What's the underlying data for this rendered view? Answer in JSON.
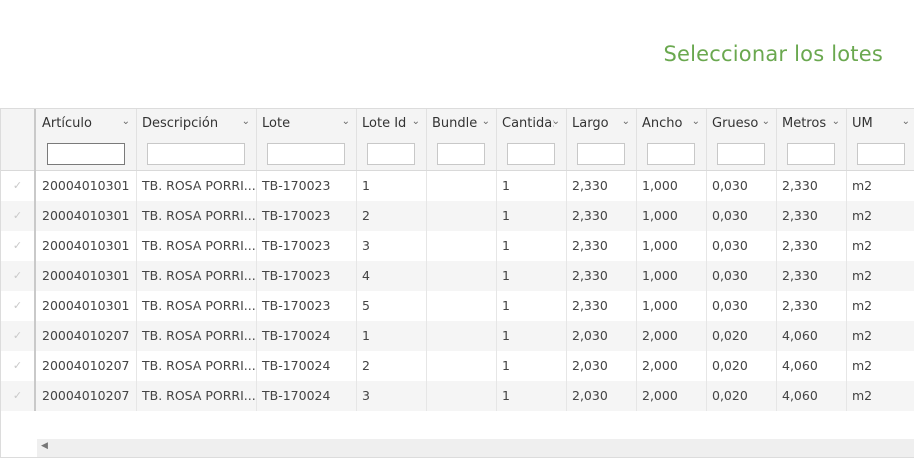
{
  "page": {
    "title": "Seleccionar los lotes"
  },
  "grid": {
    "columns": [
      {
        "label": "Artículo"
      },
      {
        "label": "Descripción"
      },
      {
        "label": "Lote"
      },
      {
        "label": "Lote Id"
      },
      {
        "label": "Bundle"
      },
      {
        "label": "Cantida:"
      },
      {
        "label": "Largo"
      },
      {
        "label": "Ancho"
      },
      {
        "label": "Grueso"
      },
      {
        "label": "Metros"
      },
      {
        "label": "UM"
      }
    ],
    "filter_values": [
      "",
      "",
      "",
      "",
      "",
      "",
      "",
      "",
      "",
      "",
      ""
    ],
    "rows": [
      [
        "20004010301",
        "TB. ROSA PORRI...",
        "TB-170023",
        "1",
        "",
        "1",
        "2,330",
        "1,000",
        "0,030",
        "2,330",
        "m2"
      ],
      [
        "20004010301",
        "TB. ROSA PORRI...",
        "TB-170023",
        "2",
        "",
        "1",
        "2,330",
        "1,000",
        "0,030",
        "2,330",
        "m2"
      ],
      [
        "20004010301",
        "TB. ROSA PORRI...",
        "TB-170023",
        "3",
        "",
        "1",
        "2,330",
        "1,000",
        "0,030",
        "2,330",
        "m2"
      ],
      [
        "20004010301",
        "TB. ROSA PORRI...",
        "TB-170023",
        "4",
        "",
        "1",
        "2,330",
        "1,000",
        "0,030",
        "2,330",
        "m2"
      ],
      [
        "20004010301",
        "TB. ROSA PORRI...",
        "TB-170023",
        "5",
        "",
        "1",
        "2,330",
        "1,000",
        "0,030",
        "2,330",
        "m2"
      ],
      [
        "20004010207",
        "TB. ROSA PORRI...",
        "TB-170024",
        "1",
        "",
        "1",
        "2,030",
        "2,000",
        "0,020",
        "4,060",
        "m2"
      ],
      [
        "20004010207",
        "TB. ROSA PORRI...",
        "TB-170024",
        "2",
        "",
        "1",
        "2,030",
        "2,000",
        "0,020",
        "4,060",
        "m2"
      ],
      [
        "20004010207",
        "TB. ROSA PORRI...",
        "TB-170024",
        "3",
        "",
        "1",
        "2,030",
        "2,000",
        "0,020",
        "4,060",
        "m2"
      ]
    ],
    "row_check_icon": "checkmark-icon",
    "sort_icon": "chevron-down-icon",
    "scroll_icon": "scroll-left-arrow-icon",
    "colors": {
      "title": "#6aa84f",
      "header_bg": "#f4f4f4",
      "alt_row": "#f5f5f5"
    }
  }
}
